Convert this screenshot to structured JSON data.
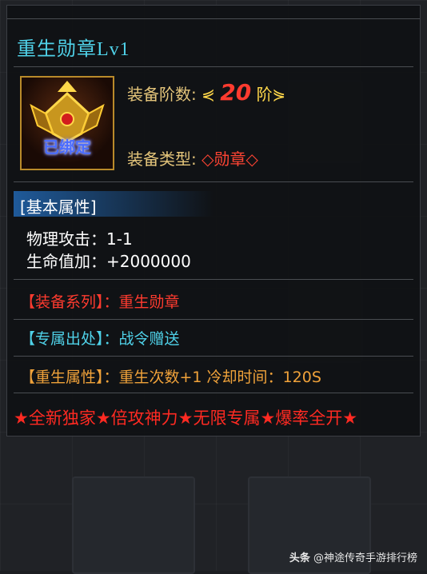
{
  "item": {
    "title": "重生勋章Lv1",
    "bound_label": "已绑定",
    "tier_label": "装备阶数:",
    "tier_prefix": "⋞",
    "tier_value": "20",
    "tier_suffix": "阶⋟",
    "type_label": "装备类型:",
    "type_value": "◇勋章◇"
  },
  "basic": {
    "header": "[基本属性]",
    "stats": [
      {
        "label": "物理攻击：",
        "value": "1-1"
      },
      {
        "label": "生命值加：",
        "value": "+2000000"
      }
    ]
  },
  "lines": {
    "series": "【装备系列】：重生勋章",
    "source": "【专属出处】：战令赠送",
    "rebirth": "【重生属性】：重生次数+1  冷却时间：120S"
  },
  "banner": "★全新独家★倍攻神力★无限专属★爆率全开★",
  "watermark": {
    "prefix": "头条",
    "text": " @神途传奇手游排行榜"
  }
}
